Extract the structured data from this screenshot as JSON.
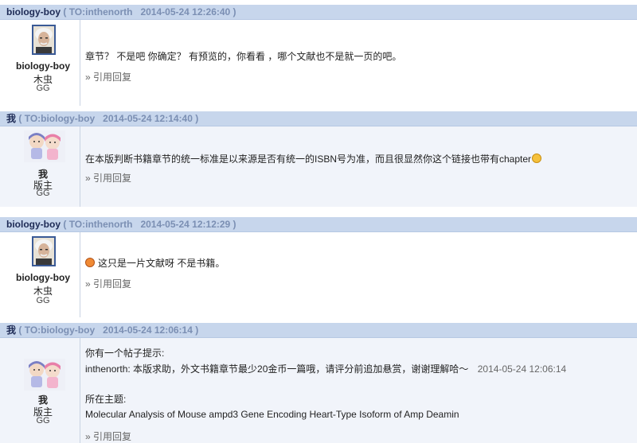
{
  "posts": [
    {
      "author": "biology-boy",
      "to": "TO:inthenorth",
      "date": "2014-05-24 12:26:40",
      "user": {
        "name": "biology-boy",
        "rank": "木虫",
        "group": "GG",
        "avatar": "einstein-avatar"
      },
      "content": "章节？ 不是吧 你确定？ 有预览的，你看看 ，哪个文献也不是就一页的吧。",
      "quote_label": "» 引用回复"
    },
    {
      "author": "我",
      "to": "TO:biology-boy",
      "date": "2014-05-24 12:14:40",
      "user": {
        "name": "我",
        "rank": "版主",
        "group": "GG",
        "avatar": "cartoon-couple-avatar"
      },
      "content": "在本版判断书籍章节的统一标准是以来源是否有统一的ISBN号为准，而且很显然你这个链接也带有chapter",
      "quote_label": "» 引用回复"
    },
    {
      "author": "biology-boy",
      "to": "TO:inthenorth",
      "date": "2014-05-24 12:12:29",
      "user": {
        "name": "biology-boy",
        "rank": "木虫",
        "group": "GG",
        "avatar": "einstein-avatar"
      },
      "content": "这只是一片文献呀 不是书籍。",
      "quote_label": "» 引用回复"
    },
    {
      "author": "我",
      "to": "TO:biology-boy",
      "date": "2014-05-24 12:06:14",
      "user": {
        "name": "我",
        "rank": "版主",
        "group": "GG",
        "avatar": "cartoon-couple-avatar"
      },
      "notice_title": "你有一个帖子提示:",
      "notice_line": "inthenorth: 本版求助，外文书籍章节最少20金币一篇哦，请评分前追加悬赏，谢谢理解哈～",
      "notice_date": "2014-05-24 12:06:14",
      "topic_title": "所在主题:",
      "topic_line": "Molecular Analysis of Mouse ampd3 Gene Encoding Heart-Type Isoform of Amp Deamin",
      "quote_label": "» 引用回复"
    }
  ],
  "colors": {
    "header_bg": "#c7d6ec",
    "author": "#1d2a55",
    "meta": "#7b8fb3",
    "mod_row_bg": "#f1f4fa"
  }
}
